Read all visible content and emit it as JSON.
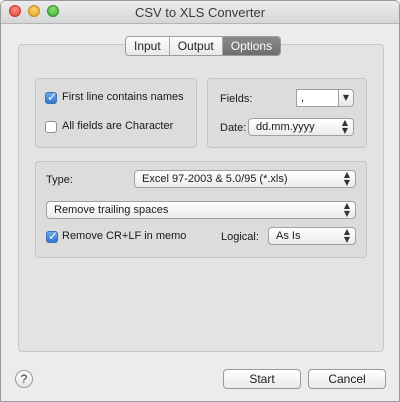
{
  "window": {
    "title": "CSV to XLS Converter"
  },
  "tabs": [
    "Input",
    "Output",
    "Options"
  ],
  "active_tab": "Options",
  "names_group": {
    "first_line_names": {
      "label": "First line contains names",
      "checked": true
    },
    "all_character": {
      "label": "All fields are Character",
      "checked": false
    }
  },
  "fields_group": {
    "fields_label": "Fields:",
    "fields_value": ",",
    "date_label": "Date:",
    "date_value": "dd.mm.yyyy"
  },
  "type_group": {
    "type_label": "Type:",
    "type_value": "Excel 97-2003 & 5.0/95 (*.xls)",
    "trailing_value": "Remove trailing spaces",
    "remove_crlf": {
      "label": "Remove CR+LF in memo",
      "checked": true
    },
    "logical_label": "Logical:",
    "logical_value": "As Is"
  },
  "footer": {
    "help": "?",
    "start": "Start",
    "cancel": "Cancel"
  },
  "colors": {
    "accent": "#2f77d0",
    "active_tab": "#7a7a7a"
  },
  "icons": [
    "close-icon",
    "minimize-icon",
    "zoom-icon",
    "checkmark-icon",
    "popup-arrows-icon",
    "help-icon"
  ]
}
